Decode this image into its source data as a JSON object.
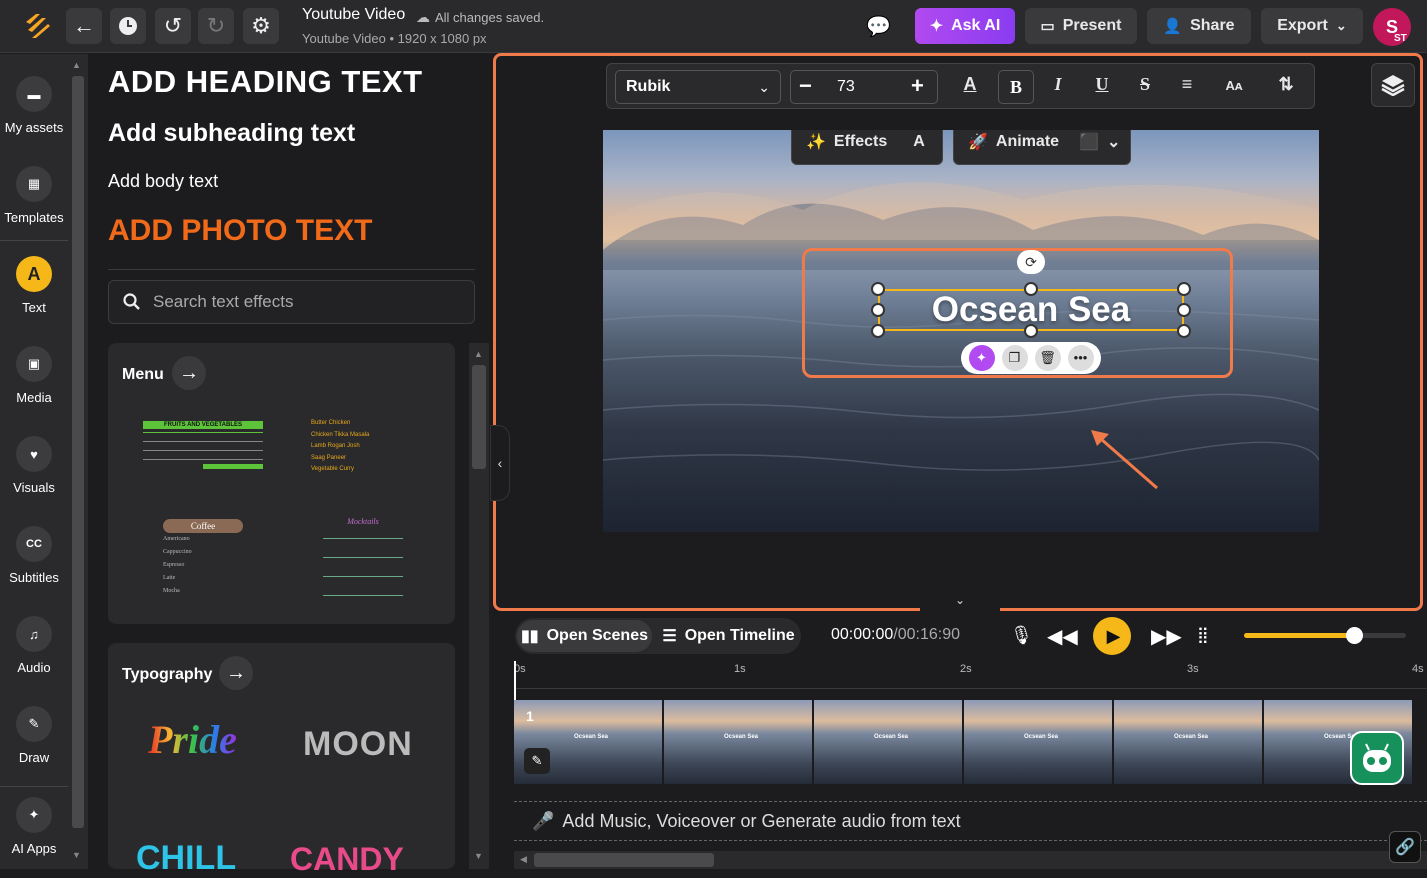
{
  "header": {
    "title": "Youtube Video",
    "save_status": "All changes saved.",
    "subtitle": "Youtube Video • 1920 x 1080 px",
    "ask_ai": "Ask AI",
    "present": "Present",
    "share": "Share",
    "export": "Export",
    "avatar_initial": "S",
    "avatar_badge": "ST"
  },
  "sidebar": {
    "items": [
      {
        "label": "My assets",
        "icon": "folder-icon"
      },
      {
        "label": "Templates",
        "icon": "templates-icon"
      },
      {
        "label": "Text",
        "icon": "text-icon"
      },
      {
        "label": "Media",
        "icon": "image-icon"
      },
      {
        "label": "Visuals",
        "icon": "visuals-icon"
      },
      {
        "label": "Subtitles",
        "icon": "cc-icon"
      },
      {
        "label": "Audio",
        "icon": "music-icon"
      },
      {
        "label": "Draw",
        "icon": "pen-icon"
      },
      {
        "label": "AI Apps",
        "icon": "sparkle-icon"
      }
    ]
  },
  "panel": {
    "heading": "ADD HEADING TEXT",
    "subheading": "Add subheading text",
    "body": "Add body text",
    "photo": "ADD PHOTO TEXT",
    "search_placeholder": "Search text effects",
    "menu_title": "Menu",
    "menu1_title": "FRUITS AND VEGETABLES",
    "menu2_items": [
      "Butter Chicken",
      "Chicken Tikka Masala",
      "Lamb Rogan Josh",
      "Saag Paneer",
      "Vegetable Curry"
    ],
    "menu3_title": "Coffee",
    "menu3_items": [
      "Americano",
      "Cappuccino",
      "Espresso",
      "Latte",
      "Mocha"
    ],
    "menu4_title": "Mocktails",
    "typography_title": "Typography",
    "typo": [
      "Pride",
      "MOON",
      "CHILL",
      "CANDY"
    ]
  },
  "toolbar": {
    "font": "Rubik",
    "size": "73",
    "effects": "Effects",
    "animate": "Animate"
  },
  "canvas": {
    "text": "Ocsean Sea",
    "accent": "#f07a4a"
  },
  "timeline": {
    "open_scenes": "Open Scenes",
    "open_timeline": "Open Timeline",
    "current_time": "00:00:00",
    "total_time": "/00:16:90",
    "ticks": [
      "0s",
      "1s",
      "2s",
      "3s",
      "4s"
    ],
    "scene_number": "1",
    "frame_label": "Ocsean Sea",
    "audio_prompt": "Add Music, Voiceover or Generate audio from text",
    "volume": 0.68
  }
}
